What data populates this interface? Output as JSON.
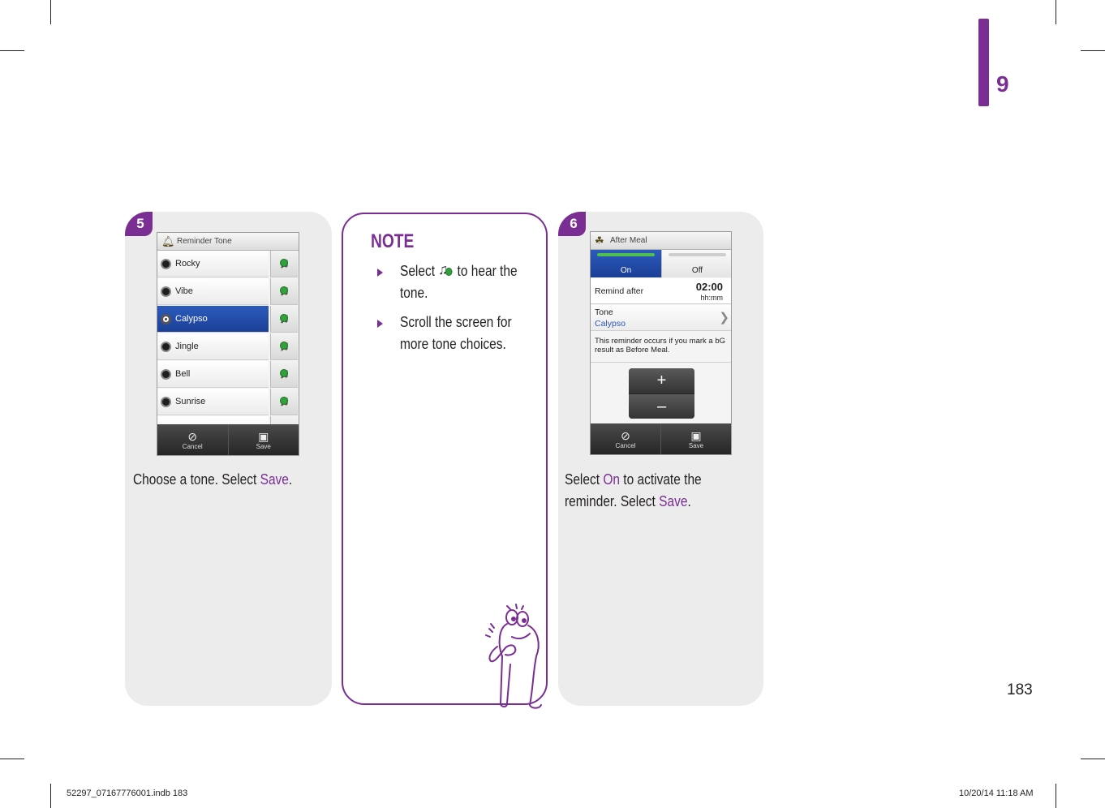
{
  "chapter": {
    "number": "9"
  },
  "page_number": "183",
  "footer": {
    "file": "52297_07167776001.indb   183",
    "date": "10/20/14   11:18 AM"
  },
  "colors": {
    "accent": "#7a2e94",
    "panel": "#ececed",
    "selection": "#1b3f96"
  },
  "step5": {
    "badge": "5",
    "screen": {
      "title": "Reminder Tone",
      "title_icon": "bell-icon",
      "tones": [
        "Rocky",
        "Vibe",
        "Calypso",
        "Jingle",
        "Bell",
        "Sunrise"
      ],
      "selected": "Calypso",
      "bottom": {
        "cancel": "Cancel",
        "save": "Save"
      }
    },
    "caption": {
      "pre": "Choose a tone. Select ",
      "hl": "Save",
      "post": "."
    }
  },
  "note": {
    "title": "NOTE",
    "item1": {
      "pre": "Select",
      "post": " to hear the tone."
    },
    "item2": "Scroll the screen for more tone choices.",
    "icons": [
      "tone-play-icon",
      "thinking-mascot-icon"
    ]
  },
  "step6": {
    "badge": "6",
    "screen": {
      "title": "After Meal",
      "title_icon": "apple-core-icon",
      "on": "On",
      "off": "Off",
      "remind_label": "Remind after",
      "remind_value": "02:00",
      "remind_unit": "hh:mm",
      "tone_label": "Tone",
      "tone_value": "Calypso",
      "info": "This reminder occurs if you mark a bG result as Before Meal.",
      "plus": "+",
      "minus": "–",
      "bottom": {
        "cancel": "Cancel",
        "save": "Save"
      }
    },
    "caption": {
      "pre1": "Select ",
      "hl1": "On",
      "mid": " to activate the reminder. Select ",
      "hl2": "Save",
      "post": "."
    }
  }
}
